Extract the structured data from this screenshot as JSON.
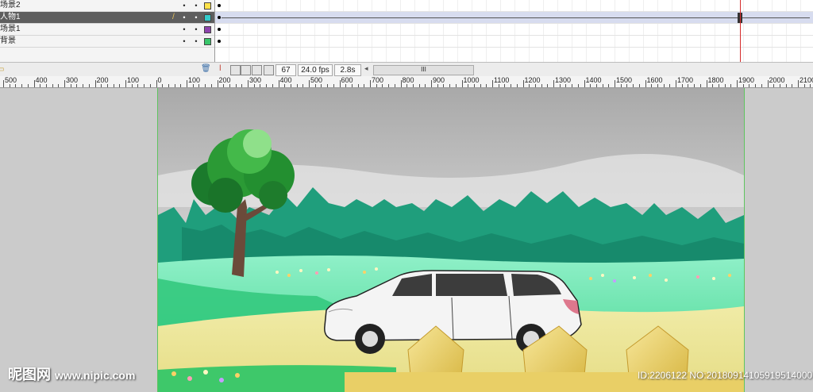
{
  "layers": [
    {
      "name": "场景2",
      "color": "#ffe24a",
      "selected": false
    },
    {
      "name": "人物1",
      "color": "#33cccc",
      "selected": true
    },
    {
      "name": "场景1",
      "color": "#8e44ad",
      "selected": false
    },
    {
      "name": "背景",
      "color": "#39c66b",
      "selected": false
    }
  ],
  "status": {
    "frame": "67",
    "fps": "24.0 fps",
    "time": "2.8s",
    "scroll_grip": "III"
  },
  "ruler": {
    "labels": [
      "500",
      "400",
      "300",
      "200",
      "100",
      "0",
      "100",
      "200",
      "300",
      "400",
      "500",
      "600",
      "700",
      "800",
      "900",
      "1000",
      "1100",
      "1200",
      "1300",
      "1400",
      "1500",
      "1600",
      "1700",
      "1800",
      "1900",
      "2000",
      "2100"
    ]
  },
  "watermark": {
    "brand": "昵图网",
    "url": "www.nipic.com",
    "id": "ID:2206122 NO:20180914105919514000"
  }
}
